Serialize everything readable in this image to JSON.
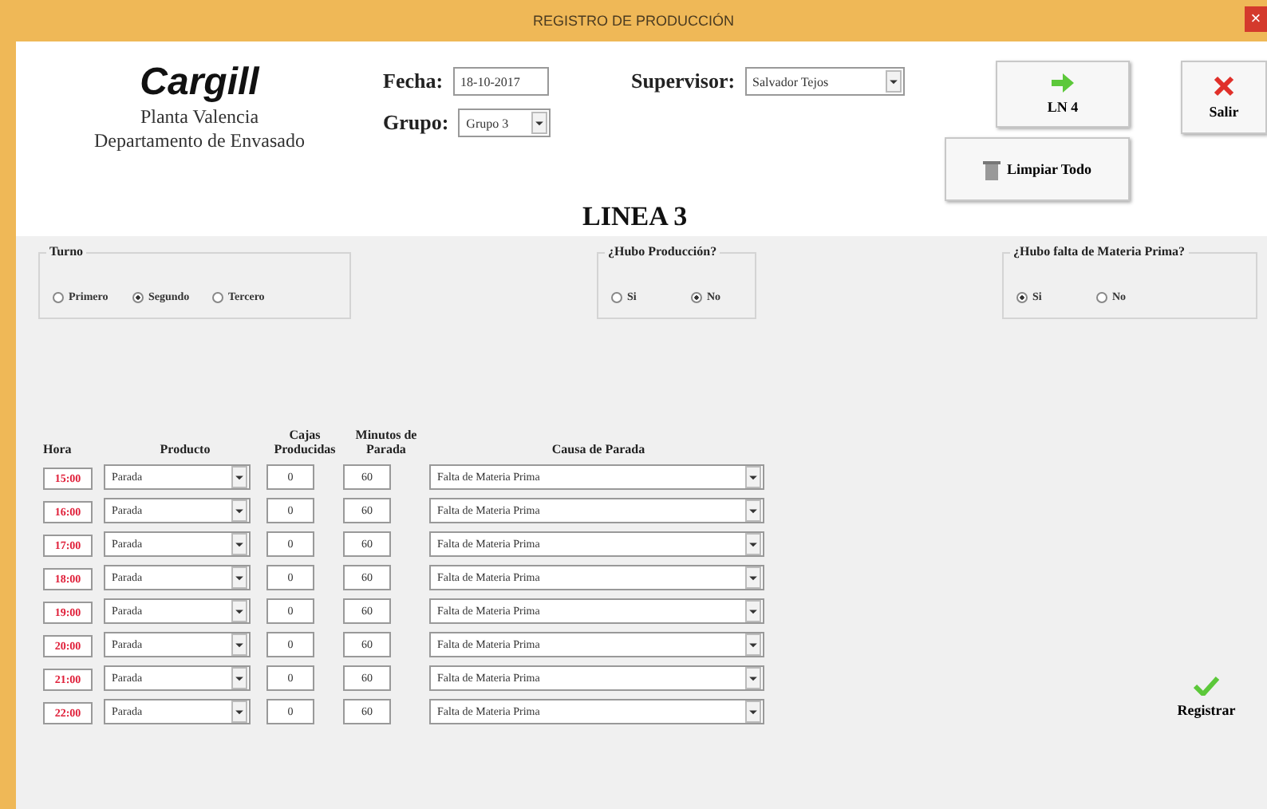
{
  "window": {
    "title": "REGISTRO DE PRODUCCIÓN",
    "close": "×"
  },
  "logo": {
    "brand": "Cargill",
    "line1": "Planta Valencia",
    "line2": "Departamento de Envasado"
  },
  "fecha": {
    "label": "Fecha:",
    "value": "18-10-2017"
  },
  "supervisor": {
    "label": "Supervisor:",
    "value": "Salvador Tejos"
  },
  "grupo": {
    "label": "Grupo:",
    "value": "Grupo 3"
  },
  "buttons": {
    "ln": "LN 4",
    "salir": "Salir",
    "limpiar": "Limpiar Todo",
    "registrar": "Registrar"
  },
  "heading": "LINEA 3",
  "groups": [
    {
      "title": "Turno",
      "options": [
        {
          "label": "Primero",
          "selected": false
        },
        {
          "label": "Segundo",
          "selected": true
        },
        {
          "label": "Tercero",
          "selected": false
        }
      ]
    },
    {
      "title": "¿Hubo Producción?",
      "options": [
        {
          "label": "Si",
          "selected": false
        },
        {
          "label": "No",
          "selected": true
        }
      ]
    },
    {
      "title": "¿Hubo falta de Materia Prima?",
      "options": [
        {
          "label": "Si",
          "selected": true
        },
        {
          "label": "No",
          "selected": false
        }
      ]
    }
  ],
  "columns": [
    "Hora",
    "Producto",
    "Cajas Producidas",
    "Minutos de Parada",
    "Causa de Parada"
  ],
  "rows": [
    {
      "hora": "15:00",
      "producto": "Parada",
      "cajas": "0",
      "minutos": "60",
      "causa": "Falta de Materia Prima"
    },
    {
      "hora": "16:00",
      "producto": "Parada",
      "cajas": "0",
      "minutos": "60",
      "causa": "Falta de Materia Prima"
    },
    {
      "hora": "17:00",
      "producto": "Parada",
      "cajas": "0",
      "minutos": "60",
      "causa": "Falta de Materia Prima"
    },
    {
      "hora": "18:00",
      "producto": "Parada",
      "cajas": "0",
      "minutos": "60",
      "causa": "Falta de Materia Prima"
    },
    {
      "hora": "19:00",
      "producto": "Parada",
      "cajas": "0",
      "minutos": "60",
      "causa": "Falta de Materia Prima"
    },
    {
      "hora": "20:00",
      "producto": "Parada",
      "cajas": "0",
      "minutos": "60",
      "causa": "Falta de Materia Prima"
    },
    {
      "hora": "21:00",
      "producto": "Parada",
      "cajas": "0",
      "minutos": "60",
      "causa": "Falta de Materia Prima"
    },
    {
      "hora": "22:00",
      "producto": "Parada",
      "cajas": "0",
      "minutos": "60",
      "causa": "Falta de Materia Prima"
    }
  ]
}
